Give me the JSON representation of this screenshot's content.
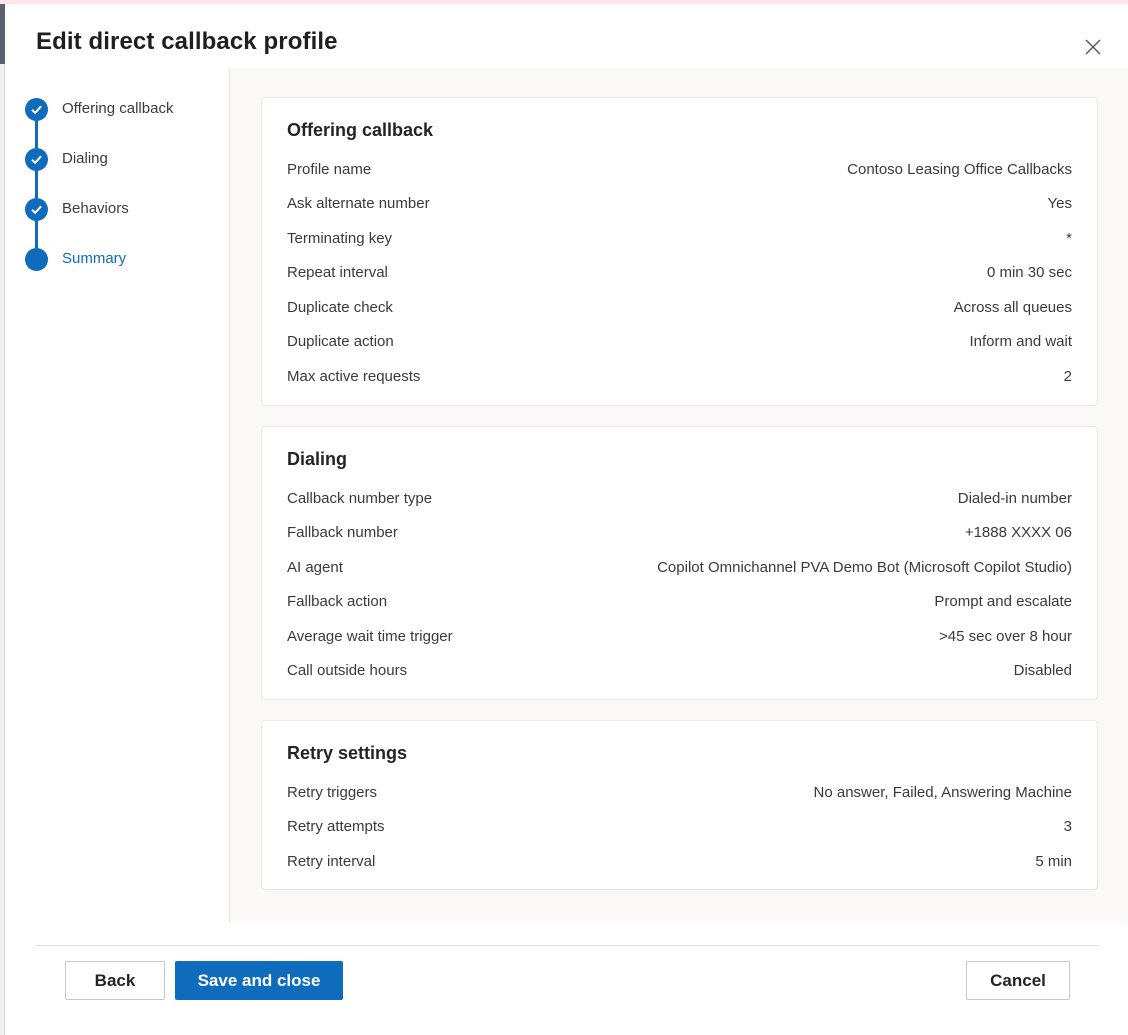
{
  "dialog": {
    "title": "Edit direct callback profile"
  },
  "nav": {
    "steps": [
      {
        "label": "Offering callback",
        "state": "complete"
      },
      {
        "label": "Dialing",
        "state": "complete"
      },
      {
        "label": "Behaviors",
        "state": "complete"
      },
      {
        "label": "Summary",
        "state": "active"
      }
    ]
  },
  "sections": {
    "offering": {
      "title": "Offering callback",
      "rows": [
        {
          "label": "Profile name",
          "value": "Contoso Leasing Office Callbacks"
        },
        {
          "label": "Ask alternate number",
          "value": "Yes"
        },
        {
          "label": "Terminating key",
          "value": "*"
        },
        {
          "label": "Repeat interval",
          "value": "0 min 30 sec"
        },
        {
          "label": "Duplicate check",
          "value": "Across all queues"
        },
        {
          "label": "Duplicate action",
          "value": "Inform and wait"
        },
        {
          "label": "Max active requests",
          "value": "2"
        }
      ]
    },
    "dialing": {
      "title": "Dialing",
      "rows": [
        {
          "label": "Callback number type",
          "value": "Dialed-in number"
        },
        {
          "label": "Fallback number",
          "value": "+1888 XXXX 06"
        },
        {
          "label": "AI agent",
          "value": "Copilot Omnichannel PVA Demo Bot (Microsoft Copilot Studio)"
        },
        {
          "label": "Fallback action",
          "value": "Prompt and escalate"
        },
        {
          "label": "Average wait time trigger",
          "value": ">45 sec over 8 hour"
        },
        {
          "label": "Call outside hours",
          "value": "Disabled"
        }
      ]
    },
    "retry": {
      "title": "Retry settings",
      "rows": [
        {
          "label": "Retry triggers",
          "value": "No answer, Failed, Answering Machine"
        },
        {
          "label": "Retry attempts",
          "value": "3"
        },
        {
          "label": "Retry interval",
          "value": "5 min"
        }
      ]
    }
  },
  "footer": {
    "back_label": "Back",
    "save_label": "Save and close",
    "cancel_label": "Cancel"
  },
  "colors": {
    "accent": "#0f6cbd",
    "panel_bg": "#faf9f8"
  }
}
